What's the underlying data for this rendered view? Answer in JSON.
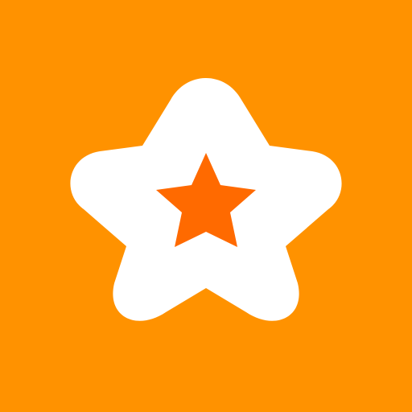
{
  "icon": {
    "name": "star-icon",
    "colors": {
      "background": "#FF9200",
      "outer_star": "#FFFFFF",
      "inner_star": "#FF6A00"
    }
  }
}
